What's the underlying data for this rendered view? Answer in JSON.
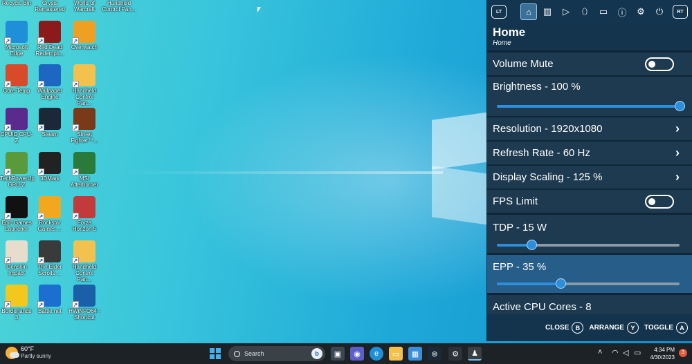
{
  "desktop": {
    "top_labels": [
      "Recycle Bin",
      "Crysis Remastered",
      "World of Warcraft",
      "Handheld Control Pan..."
    ],
    "icons": [
      {
        "label": "Microsoft Edge",
        "icon": "edge-icon",
        "color": "#1f8fd8"
      },
      {
        "label": "Red Dead Redempti...",
        "icon": "red-dead-icon",
        "color": "#8c1a1a"
      },
      {
        "label": "Overwatch",
        "icon": "overwatch-icon",
        "color": "#f0a020"
      },
      {
        "label": "Core Temp",
        "icon": "core-temp-icon",
        "color": "#d84a2a"
      },
      {
        "label": "Wallpaper Engine",
        "icon": "wallpaper-engine-icon",
        "color": "#1d66c2"
      },
      {
        "label": "Handheld Control Pan...",
        "icon": "folder-icon",
        "color": "#f2c14e"
      },
      {
        "label": "CPUID CPU-Z",
        "icon": "cpu-z-icon",
        "color": "#5a2a8c"
      },
      {
        "label": "Steam",
        "icon": "steam-icon",
        "color": "#1b2838"
      },
      {
        "label": "Street Fighter™...",
        "icon": "street-fighter-icon",
        "color": "#7a3a1a"
      },
      {
        "label": "TechPowerUp GPU-Z",
        "icon": "gpu-z-icon",
        "color": "#5a9a3a"
      },
      {
        "label": "3DMark",
        "icon": "3dmark-icon",
        "color": "#222222"
      },
      {
        "label": "MSI Afterburner",
        "icon": "msi-afterburner-icon",
        "color": "#2a7a3a"
      },
      {
        "label": "Epic Games Launcher",
        "icon": "epic-games-icon",
        "color": "#111111"
      },
      {
        "label": "Rockstar Games ...",
        "icon": "rockstar-icon",
        "color": "#f2a81e"
      },
      {
        "label": "Forza Horizon 5",
        "icon": "forza-icon",
        "color": "#c23a3a"
      },
      {
        "label": "Genshin Impact",
        "icon": "genshin-icon",
        "color": "#e8dccc"
      },
      {
        "label": "The Elder Scrolls ...",
        "icon": "skyrim-icon",
        "color": "#3a3a3a"
      },
      {
        "label": "Handheld Control Pan...",
        "icon": "folder-icon",
        "color": "#f2c14e"
      },
      {
        "label": "Borderlands 3",
        "icon": "borderlands-icon",
        "color": "#f2c81e"
      },
      {
        "label": "Battle.net",
        "icon": "battlenet-icon",
        "color": "#1a6fd0"
      },
      {
        "label": "HWiNFO64 - Shortcut",
        "icon": "hwinfo-icon",
        "color": "#1a5fa8"
      }
    ]
  },
  "panel": {
    "toolbar": {
      "left_badge": "LT",
      "right_badge": "RT",
      "buttons": [
        {
          "name": "home",
          "glyph": "⌂",
          "active": true
        },
        {
          "name": "library",
          "glyph": "▥",
          "active": false
        },
        {
          "name": "play",
          "glyph": "▷",
          "active": false
        },
        {
          "name": "mouse",
          "glyph": "⬯",
          "active": false
        },
        {
          "name": "controller",
          "glyph": "▭",
          "active": false
        },
        {
          "name": "info",
          "glyph": "ⓘ",
          "active": false
        },
        {
          "name": "settings",
          "glyph": "⚙",
          "active": false
        },
        {
          "name": "power",
          "glyph": "⏻",
          "active": false
        }
      ]
    },
    "title": "Home",
    "subtitle": "Home",
    "rows": {
      "volume_mute": {
        "label": "Volume Mute",
        "on": false
      },
      "brightness": {
        "label": "Brightness  - 100 %",
        "value": 100
      },
      "resolution": {
        "label": "Resolution  - 1920x1080"
      },
      "refresh_rate": {
        "label": "Refresh Rate  - 60 Hz"
      },
      "display_scaling": {
        "label": "Display Scaling  - 125 %"
      },
      "fps_limit": {
        "label": "FPS Limit",
        "on": false
      },
      "tdp": {
        "label": "TDP  - 15 W",
        "fraction": 0.19
      },
      "epp": {
        "label": "EPP  - 35 %",
        "value": 35
      },
      "cpu_cores": {
        "label": "Active CPU Cores  - 8"
      }
    },
    "footer": {
      "close_label": "CLOSE",
      "close_glyph": "B",
      "arrange_label": "ARRANGE",
      "arrange_glyph": "Y",
      "toggle_label": "TOGGLE",
      "toggle_glyph": "A"
    }
  },
  "taskbar": {
    "temperature": "60°F",
    "weather": "Partly sunny",
    "search_placeholder": "Search",
    "time": "4:34 PM",
    "date": "4/30/2023",
    "notification_count": "3"
  },
  "colors": {
    "panel_bg": "#14344d",
    "row_bg": "#1d3a50",
    "row_selected": "#265e89",
    "accent": "#2c8fdc"
  }
}
